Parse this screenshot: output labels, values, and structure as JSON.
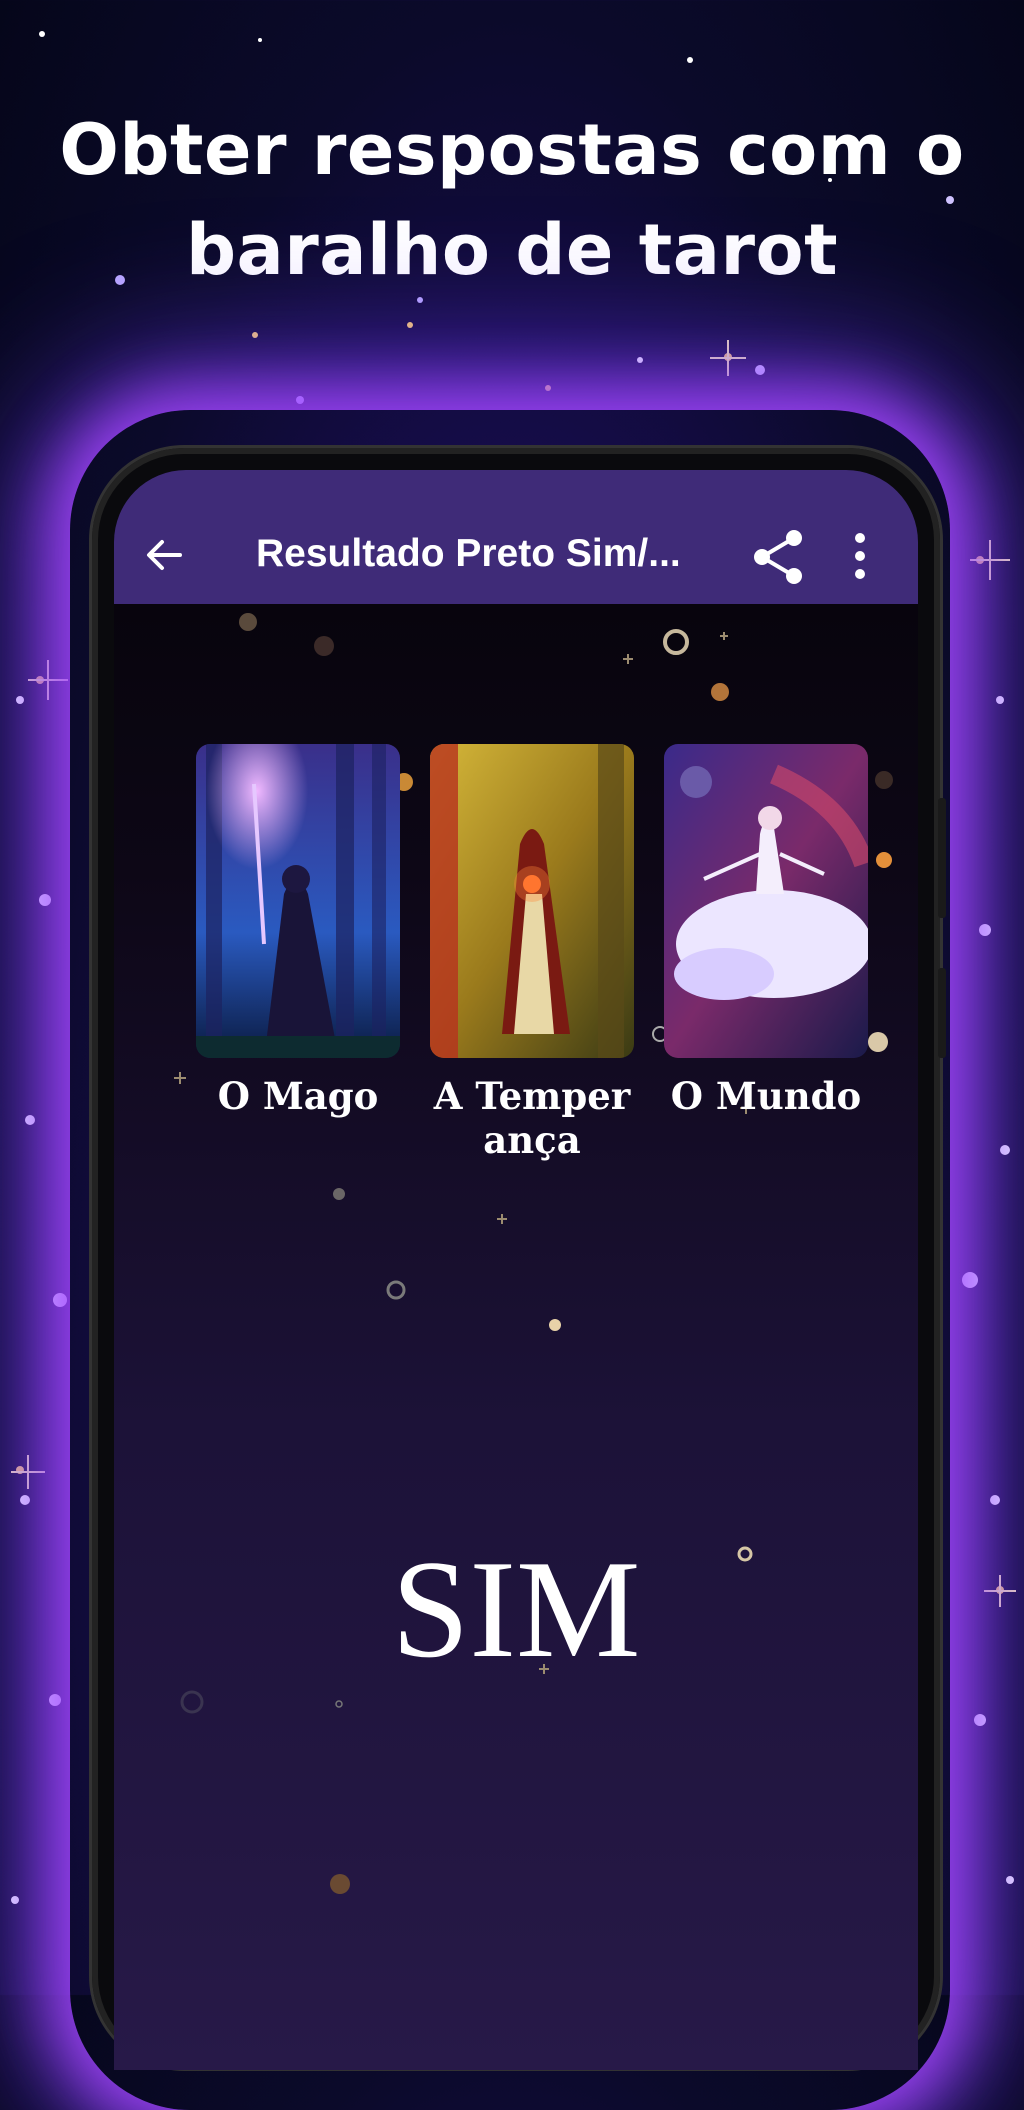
{
  "headline": {
    "line1": "Obter respostas com o",
    "line2": "baralho de tarot"
  },
  "appbar": {
    "title": "Resultado Preto Sim/...",
    "back_icon": "arrow-left-icon",
    "share_icon": "share-icon",
    "more_icon": "more-vert-icon"
  },
  "cards": [
    {
      "label": "O Mago"
    },
    {
      "label": "A Temper\nança"
    },
    {
      "label": "O Mundo"
    }
  ],
  "answer": "SIM",
  "colors": {
    "appbar": "#3f2b78",
    "glow": "#a846ff",
    "background": "#0b0a2a"
  }
}
